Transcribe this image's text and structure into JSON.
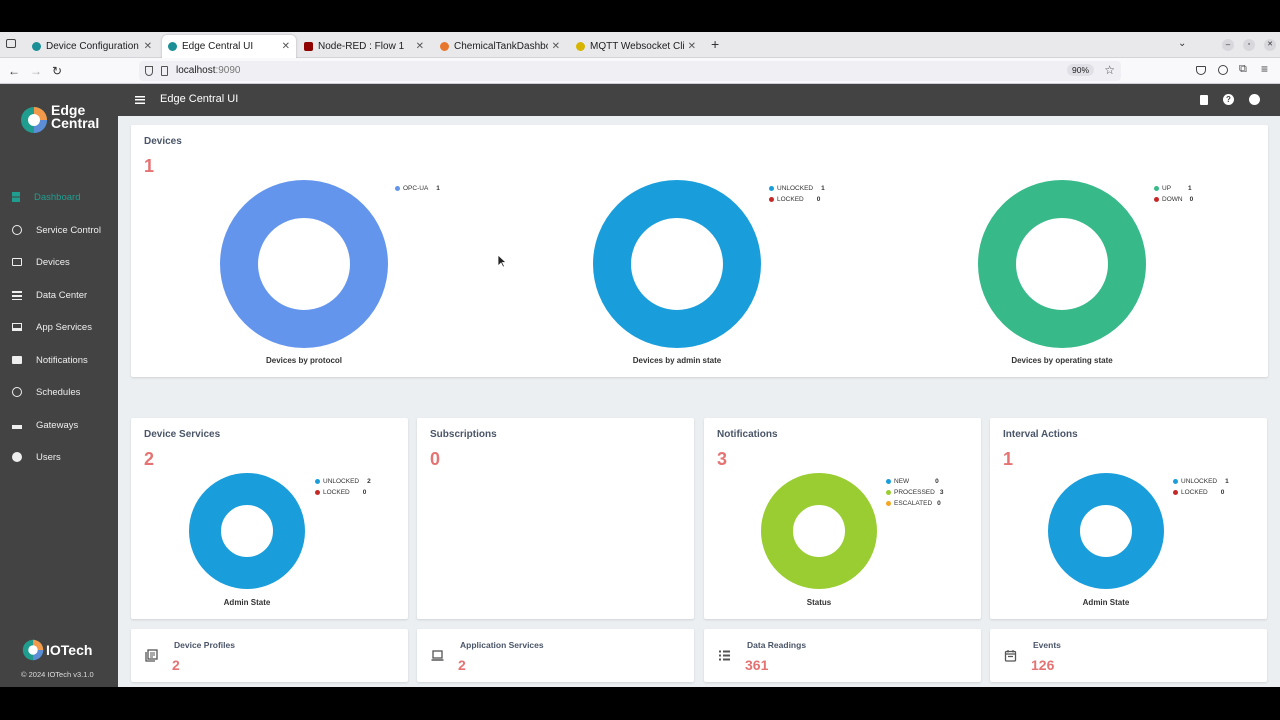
{
  "browser": {
    "tabs": [
      {
        "title": "Device Configuration Tool",
        "active": false,
        "color": "#1a8f96"
      },
      {
        "title": "Edge Central UI",
        "active": true,
        "color": "#1a8f96"
      },
      {
        "title": "Node-RED : Flow 1",
        "active": false,
        "color": "#8f0000"
      },
      {
        "title": "ChemicalTankDashboard",
        "active": false,
        "color": "#e8772e"
      },
      {
        "title": "MQTT Websocket Client",
        "active": false,
        "color": "#d6b400"
      }
    ],
    "url_host": "localhost",
    "url_port": ":9090",
    "zoom": "90%"
  },
  "app": {
    "title": "Edge Central UI",
    "logo_line1": "Edge",
    "logo_line2": "Central",
    "footer_brand": "IOTech",
    "footer_copyright": "© 2024 IOTech v3.1.0"
  },
  "sidebar": {
    "items": [
      {
        "label": "Dashboard",
        "active": true
      },
      {
        "label": "Service Control",
        "active": false
      },
      {
        "label": "Devices",
        "active": false
      },
      {
        "label": "Data Center",
        "active": false
      },
      {
        "label": "App Services",
        "active": false
      },
      {
        "label": "Notifications",
        "active": false
      },
      {
        "label": "Schedules",
        "active": false
      },
      {
        "label": "Gateways",
        "active": false
      },
      {
        "label": "Users",
        "active": false
      }
    ]
  },
  "devices": {
    "title": "Devices",
    "count": "1",
    "charts": [
      {
        "caption": "Devices by protocol",
        "color": "#6495ed",
        "legend": [
          {
            "label": "OPC-UA",
            "value": "1",
            "color": "#6495ed"
          }
        ]
      },
      {
        "caption": "Devices by admin state",
        "color": "#1a9edb",
        "legend": [
          {
            "label": "UNLOCKED",
            "value": "1",
            "color": "#1a9edb"
          },
          {
            "label": "LOCKED",
            "value": "0",
            "color": "#c62828"
          }
        ]
      },
      {
        "caption": "Devices by operating state",
        "color": "#37b98a",
        "legend": [
          {
            "label": "UP",
            "value": "1",
            "color": "#37b98a"
          },
          {
            "label": "DOWN",
            "value": "0",
            "color": "#c62828"
          }
        ]
      }
    ]
  },
  "device_services": {
    "title": "Device Services",
    "count": "2",
    "caption": "Admin State",
    "color": "#1a9edb",
    "legend": [
      {
        "label": "UNLOCKED",
        "value": "2",
        "color": "#1a9edb"
      },
      {
        "label": "LOCKED",
        "value": "0",
        "color": "#c62828"
      }
    ]
  },
  "subscriptions": {
    "title": "Subscriptions",
    "count": "0"
  },
  "notifications": {
    "title": "Notifications",
    "count": "3",
    "caption": "Status",
    "color": "#9acd32",
    "legend": [
      {
        "label": "NEW",
        "value": "0",
        "color": "#1a9edb"
      },
      {
        "label": "PROCESSED",
        "value": "3",
        "color": "#9acd32"
      },
      {
        "label": "ESCALATED",
        "value": "0",
        "color": "#f5a623"
      }
    ]
  },
  "interval_actions": {
    "title": "Interval Actions",
    "count": "1",
    "caption": "Admin State",
    "color": "#1a9edb",
    "legend": [
      {
        "label": "UNLOCKED",
        "value": "1",
        "color": "#1a9edb"
      },
      {
        "label": "LOCKED",
        "value": "0",
        "color": "#c62828"
      }
    ]
  },
  "stats": [
    {
      "label": "Device Profiles",
      "value": "2",
      "icon": "library-icon"
    },
    {
      "label": "Application Services",
      "value": "2",
      "icon": "laptop-icon"
    },
    {
      "label": "Data Readings",
      "value": "361",
      "icon": "list-icon"
    },
    {
      "label": "Events",
      "value": "126",
      "icon": "calendar-icon"
    }
  ]
}
